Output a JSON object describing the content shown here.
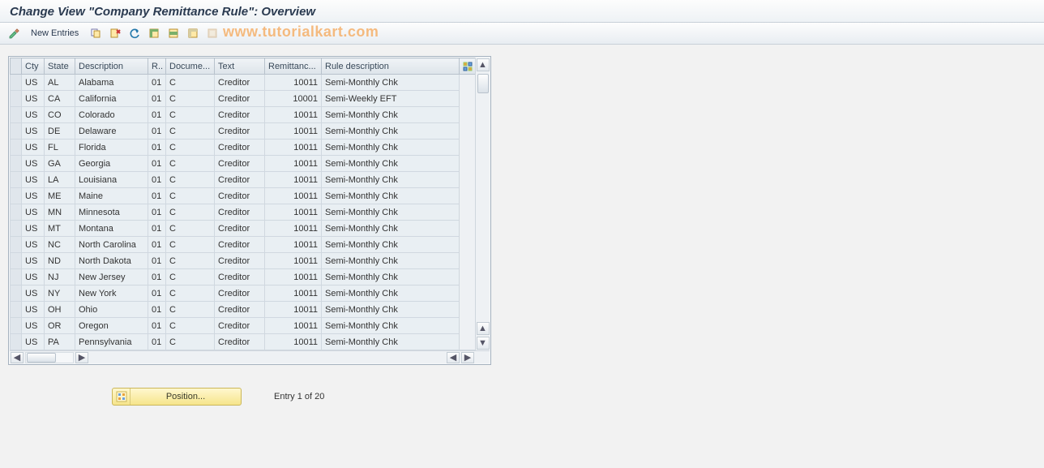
{
  "title": "Change View \"Company Remittance Rule\": Overview",
  "watermark": "www.tutorialkart.com",
  "toolbar": {
    "new_entries": "New Entries"
  },
  "columns": {
    "sel": "",
    "cty": "Cty",
    "state": "State",
    "description": "Description",
    "r": "R..",
    "docume": "Docume...",
    "text": "Text",
    "remittanc": "Remittanc...",
    "rule_description": "Rule description"
  },
  "rows": [
    {
      "cty": "US",
      "state": "AL",
      "description": "Alabama",
      "r": "01",
      "docume": "C",
      "text": "Creditor",
      "remittanc": "10011",
      "rule_description": "Semi-Monthly Chk"
    },
    {
      "cty": "US",
      "state": "CA",
      "description": "California",
      "r": "01",
      "docume": "C",
      "text": "Creditor",
      "remittanc": "10001",
      "rule_description": "Semi-Weekly EFT"
    },
    {
      "cty": "US",
      "state": "CO",
      "description": "Colorado",
      "r": "01",
      "docume": "C",
      "text": "Creditor",
      "remittanc": "10011",
      "rule_description": "Semi-Monthly Chk"
    },
    {
      "cty": "US",
      "state": "DE",
      "description": "Delaware",
      "r": "01",
      "docume": "C",
      "text": "Creditor",
      "remittanc": "10011",
      "rule_description": "Semi-Monthly Chk"
    },
    {
      "cty": "US",
      "state": "FL",
      "description": "Florida",
      "r": "01",
      "docume": "C",
      "text": "Creditor",
      "remittanc": "10011",
      "rule_description": "Semi-Monthly Chk"
    },
    {
      "cty": "US",
      "state": "GA",
      "description": "Georgia",
      "r": "01",
      "docume": "C",
      "text": "Creditor",
      "remittanc": "10011",
      "rule_description": "Semi-Monthly Chk"
    },
    {
      "cty": "US",
      "state": "LA",
      "description": "Louisiana",
      "r": "01",
      "docume": "C",
      "text": "Creditor",
      "remittanc": "10011",
      "rule_description": "Semi-Monthly Chk"
    },
    {
      "cty": "US",
      "state": "ME",
      "description": "Maine",
      "r": "01",
      "docume": "C",
      "text": "Creditor",
      "remittanc": "10011",
      "rule_description": "Semi-Monthly Chk"
    },
    {
      "cty": "US",
      "state": "MN",
      "description": "Minnesota",
      "r": "01",
      "docume": "C",
      "text": "Creditor",
      "remittanc": "10011",
      "rule_description": "Semi-Monthly Chk"
    },
    {
      "cty": "US",
      "state": "MT",
      "description": "Montana",
      "r": "01",
      "docume": "C",
      "text": "Creditor",
      "remittanc": "10011",
      "rule_description": "Semi-Monthly Chk"
    },
    {
      "cty": "US",
      "state": "NC",
      "description": "North Carolina",
      "r": "01",
      "docume": "C",
      "text": "Creditor",
      "remittanc": "10011",
      "rule_description": "Semi-Monthly Chk"
    },
    {
      "cty": "US",
      "state": "ND",
      "description": "North Dakota",
      "r": "01",
      "docume": "C",
      "text": "Creditor",
      "remittanc": "10011",
      "rule_description": "Semi-Monthly Chk"
    },
    {
      "cty": "US",
      "state": "NJ",
      "description": "New Jersey",
      "r": "01",
      "docume": "C",
      "text": "Creditor",
      "remittanc": "10011",
      "rule_description": "Semi-Monthly Chk"
    },
    {
      "cty": "US",
      "state": "NY",
      "description": "New York",
      "r": "01",
      "docume": "C",
      "text": "Creditor",
      "remittanc": "10011",
      "rule_description": "Semi-Monthly Chk"
    },
    {
      "cty": "US",
      "state": "OH",
      "description": "Ohio",
      "r": "01",
      "docume": "C",
      "text": "Creditor",
      "remittanc": "10011",
      "rule_description": "Semi-Monthly Chk"
    },
    {
      "cty": "US",
      "state": "OR",
      "description": "Oregon",
      "r": "01",
      "docume": "C",
      "text": "Creditor",
      "remittanc": "10011",
      "rule_description": "Semi-Monthly Chk"
    },
    {
      "cty": "US",
      "state": "PA",
      "description": "Pennsylvania",
      "r": "01",
      "docume": "C",
      "text": "Creditor",
      "remittanc": "10011",
      "rule_description": "Semi-Monthly Chk"
    }
  ],
  "footer": {
    "position": "Position...",
    "entry": "Entry 1 of 20"
  }
}
